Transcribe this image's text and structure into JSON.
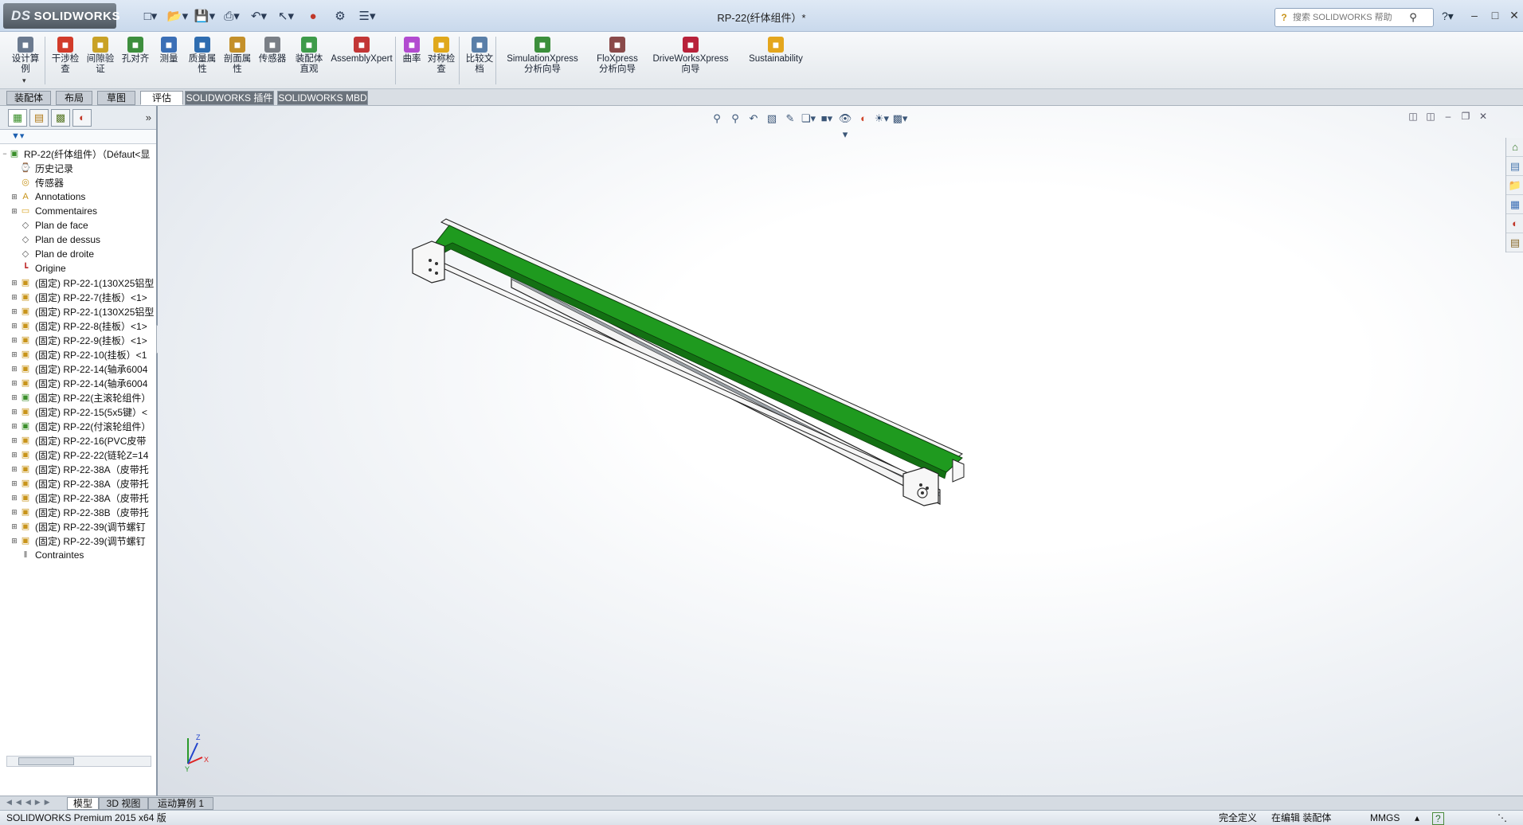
{
  "app": {
    "brand_prefix": "DS",
    "brand": "SOLIDWORKS",
    "window_title": "RP-22(纤体组件）*",
    "help_search_placeholder": "搜索 SOLIDWORKS 帮助"
  },
  "quick_access": {
    "icons": [
      "new-icon",
      "open-icon",
      "save-icon",
      "print-icon",
      "undo-icon",
      "select-icon",
      "traffic-light-icon",
      "options-icon",
      "customize-icon"
    ]
  },
  "command_manager": {
    "items": [
      {
        "label": "设计算\n例",
        "icon": "design-study-icon",
        "color": "#6b7a8f"
      },
      {
        "label": "干涉检\n查",
        "icon": "interference-icon",
        "color": "#d23b2a"
      },
      {
        "label": "间隙验\n证",
        "icon": "clearance-icon",
        "color": "#c9a227"
      },
      {
        "label": "孔对齐",
        "icon": "hole-align-icon",
        "color": "#3e8f3e"
      },
      {
        "label": "测量",
        "icon": "measure-icon",
        "color": "#3b6fb6"
      },
      {
        "label": "质量属\n性",
        "icon": "mass-props-icon",
        "color": "#2f6db0"
      },
      {
        "label": "剖面属\n性",
        "icon": "section-props-icon",
        "color": "#c4902a"
      },
      {
        "label": "传感器",
        "icon": "sensor-icon",
        "color": "#7a7f86"
      },
      {
        "label": "装配体\n直观",
        "icon": "assembly-visual-icon",
        "color": "#3e9b4a"
      },
      {
        "label": "AssemblyXpert",
        "icon": "assemblyxpert-icon",
        "color": "#c23636"
      },
      {
        "label": "曲率",
        "icon": "curvature-icon",
        "color": "#b24bd0"
      },
      {
        "label": "对称检\n查",
        "icon": "symmetry-icon",
        "color": "#e0a81c"
      },
      {
        "label": "比较文\n档",
        "icon": "compare-icon",
        "color": "#5a7fa8"
      },
      {
        "label": "SimulationXpress\n分析向导",
        "icon": "simulationxpress-icon",
        "color": "#3c8f3c"
      },
      {
        "label": "FloXpress\n分析向导",
        "icon": "floxpress-icon",
        "color": "#8a4a4a"
      },
      {
        "label": "DriveWorksXpress\n向导",
        "icon": "driveworksxpress-icon",
        "color": "#b8223a"
      },
      {
        "label": "Sustainability",
        "icon": "sustainability-icon",
        "color": "#e4a61d"
      }
    ]
  },
  "tabs": [
    {
      "label": "装配体",
      "active": false
    },
    {
      "label": "布局",
      "active": false
    },
    {
      "label": "草图",
      "active": false
    },
    {
      "label": "评估",
      "active": true
    },
    {
      "label": "SOLIDWORKS 插件",
      "active": false
    },
    {
      "label": "SOLIDWORKS MBD",
      "active": false
    }
  ],
  "feature_tree": {
    "root": "RP-22(纤体组件）（Défaut<显",
    "items": [
      {
        "label": "历史记录",
        "icon": "history-icon",
        "expandable": false
      },
      {
        "label": "传感器",
        "icon": "sensor-folder-icon",
        "expandable": false
      },
      {
        "label": "Annotations",
        "icon": "annotations-icon",
        "expandable": true
      },
      {
        "label": "Commentaires",
        "icon": "folder-icon",
        "expandable": true
      },
      {
        "label": "Plan de face",
        "icon": "plane-icon",
        "expandable": false
      },
      {
        "label": "Plan de dessus",
        "icon": "plane-icon",
        "expandable": false
      },
      {
        "label": "Plan de droite",
        "icon": "plane-icon",
        "expandable": false
      },
      {
        "label": "Origine",
        "icon": "origin-icon",
        "expandable": false
      },
      {
        "label": "(固定) RP-22-1(130X25铝型",
        "icon": "part-icon",
        "expandable": true
      },
      {
        "label": "(固定) RP-22-7(挂板）<1>",
        "icon": "part-icon",
        "expandable": true
      },
      {
        "label": "(固定) RP-22-1(130X25铝型",
        "icon": "part-icon",
        "expandable": true
      },
      {
        "label": "(固定) RP-22-8(挂板）<1>",
        "icon": "part-icon",
        "expandable": true
      },
      {
        "label": "(固定) RP-22-9(挂板）<1>",
        "icon": "part-icon",
        "expandable": true
      },
      {
        "label": "(固定) RP-22-10(挂板）<1",
        "icon": "part-icon",
        "expandable": true
      },
      {
        "label": "(固定) RP-22-14(轴承6004",
        "icon": "part-icon",
        "expandable": true
      },
      {
        "label": "(固定) RP-22-14(轴承6004",
        "icon": "part-icon",
        "expandable": true
      },
      {
        "label": "(固定) RP-22(主滚轮组件）",
        "icon": "subassembly-icon",
        "expandable": true
      },
      {
        "label": "(固定) RP-22-15(5x5键）<",
        "icon": "part-icon",
        "expandable": true
      },
      {
        "label": "(固定) RP-22(付滚轮组件）",
        "icon": "subassembly-icon",
        "expandable": true
      },
      {
        "label": "(固定) RP-22-16(PVC皮带",
        "icon": "part-icon",
        "expandable": true
      },
      {
        "label": "(固定) RP-22-22(链轮Z=14",
        "icon": "part-icon",
        "expandable": true
      },
      {
        "label": "(固定) RP-22-38A（皮带托",
        "icon": "part-icon",
        "expandable": true
      },
      {
        "label": "(固定) RP-22-38A（皮带托",
        "icon": "part-icon",
        "expandable": true
      },
      {
        "label": "(固定) RP-22-38A（皮带托",
        "icon": "part-icon",
        "expandable": true
      },
      {
        "label": "(固定) RP-22-38B（皮带托",
        "icon": "part-icon",
        "expandable": true
      },
      {
        "label": "(固定) RP-22-39(调节螺钉",
        "icon": "part-icon",
        "expandable": true
      },
      {
        "label": "(固定) RP-22-39(调节螺钉",
        "icon": "part-icon",
        "expandable": true
      },
      {
        "label": "Contraintes",
        "icon": "mates-icon",
        "expandable": false
      }
    ]
  },
  "bottom_tabs": [
    {
      "label": "模型",
      "active": true
    },
    {
      "label": "3D 视图",
      "active": false
    },
    {
      "label": "运动算例 1",
      "active": false
    }
  ],
  "status": {
    "product": "SOLIDWORKS Premium 2015 x64 版",
    "definition": "完全定义",
    "editing": "在编辑 装配体",
    "units": "MMGS"
  },
  "colors": {
    "belt": "#1f9a1f",
    "belt_dark": "#137013",
    "frame": "#f4f4f4",
    "accent": "#1c5fb0"
  },
  "triad": {
    "axis_x": "X",
    "axis_y": "Y",
    "axis_z": "Z"
  }
}
